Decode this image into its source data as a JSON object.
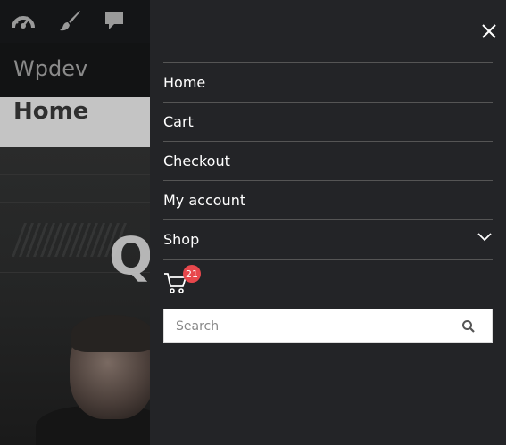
{
  "admin_bar": {
    "icons": [
      "dashboard-icon",
      "customize-brush-icon",
      "comments-icon"
    ]
  },
  "site": {
    "title": "Wpdev"
  },
  "page": {
    "heading": "Home",
    "hero_letter": "Q"
  },
  "mobile_menu": {
    "close_icon": "close-icon",
    "items": [
      {
        "label": "Home"
      },
      {
        "label": "Cart"
      },
      {
        "label": "Checkout"
      },
      {
        "label": "My account"
      },
      {
        "label": "Shop",
        "has_submenu": true
      }
    ],
    "cart": {
      "icon": "cart-icon",
      "count": "21"
    },
    "search": {
      "placeholder": "Search",
      "value": "",
      "icon": "search-icon"
    }
  },
  "colors": {
    "panel_bg": "#232427",
    "badge": "#e8474c",
    "divider": "#555555"
  }
}
